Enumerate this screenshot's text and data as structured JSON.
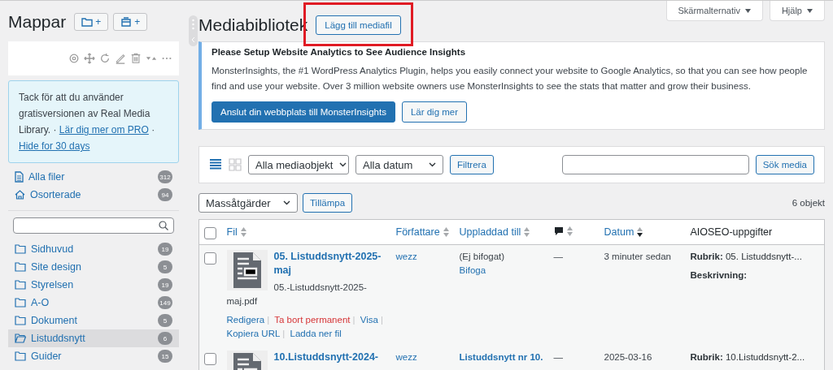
{
  "sidebar": {
    "title": "Mappar",
    "add_buttons": [
      {
        "kind": "folder",
        "label": "+"
      },
      {
        "kind": "collection",
        "label": "+"
      }
    ],
    "notice": [
      {
        "kind": "text",
        "text": "Tack för att du använder gratisversionen av Real Media Library. ·"
      },
      {
        "kind": "link",
        "text": "Lär dig mer om PRO"
      },
      {
        "kind": "text",
        "text": "·"
      },
      {
        "kind": "link",
        "text": "Hide for 30 days"
      }
    ],
    "special": [
      {
        "kind": "file",
        "label": "Alla filer",
        "count": "312"
      },
      {
        "kind": "home",
        "label": "Osorterade",
        "count": "94"
      }
    ],
    "folders": [
      {
        "label": "Sidhuvud",
        "count": "19",
        "selected": false
      },
      {
        "label": "Site design",
        "count": "5",
        "selected": false
      },
      {
        "label": "Styrelsen",
        "count": "19",
        "selected": false
      },
      {
        "label": "A-O",
        "count": "149",
        "selected": false
      },
      {
        "label": "Dokument",
        "count": "5",
        "selected": false
      },
      {
        "label": "Listuddsnytt",
        "count": "6",
        "selected": true
      },
      {
        "label": "Guider",
        "count": "15",
        "selected": false
      }
    ]
  },
  "header": {
    "title": "Mediabibliotek",
    "add_button": "Lägg till mediafil",
    "tabs": [
      "Skärmalternativ",
      "Hjälp"
    ]
  },
  "notice": {
    "title": "Please Setup Website Analytics to See Audience Insights",
    "text": "MonsterInsights, the #1 WordPress Analytics Plugin, helps you easily connect your website to Google Analytics, so that you can see how people find and use your website. Over 3 million website owners use MonsterInsights to see the stats that matter and grow their business.",
    "buttons": [
      {
        "kind": "primary",
        "label": "Anslut din webbplats till MonsterInsights"
      },
      {
        "kind": "secondary",
        "label": "Lär dig mer"
      }
    ]
  },
  "filters": {
    "views": [
      {
        "kind": "list",
        "selected": true
      },
      {
        "kind": "grid",
        "selected": false
      }
    ],
    "selects": [
      "Alla mediaobjekt",
      "Alla datum"
    ],
    "filter_button": "Filtrera",
    "search_button": "Sök media"
  },
  "bulk": {
    "select": "Massåtgärder",
    "apply": "Tillämpa",
    "count": "6 objekt"
  },
  "table": {
    "select_all_checked": false,
    "action_separator": "|",
    "columns": [
      {
        "kind": "text",
        "label": "Fil",
        "sortable": true,
        "sorted_desc": false
      },
      {
        "kind": "text",
        "label": "Författare",
        "sortable": true,
        "sorted_desc": false
      },
      {
        "kind": "text",
        "label": "Uppladdad till",
        "sortable": true,
        "sorted_desc": false
      },
      {
        "kind": "comment",
        "sortable": true,
        "sorted_desc": false
      },
      {
        "kind": "text",
        "label": "Datum",
        "sortable": true,
        "sorted_desc": true
      },
      {
        "kind": "plain",
        "label": "AIOSEO-uppgifter",
        "sortable": false
      }
    ],
    "rows": [
      {
        "checked": false,
        "title": "05. Listuddsnytt-2025-maj",
        "filename": "05.-Listuddsnytt-2025-maj.pdf",
        "actions": [
          {
            "kind": "normal",
            "label": "Redigera"
          },
          {
            "kind": "danger",
            "label": "Ta bort permanent"
          },
          {
            "kind": "normal",
            "label": "Visa"
          },
          {
            "kind": "normal",
            "label": "Kopiera URL"
          },
          {
            "kind": "normal",
            "label": "Ladda ner fil"
          }
        ],
        "author": "wezz",
        "uploaded": {
          "kind": "unattached",
          "note": "(Ej bifogat)",
          "link": "Bifoga"
        },
        "comments": "—",
        "date": "3 minuter sedan",
        "seo": [
          {
            "label": "Rubrik:",
            "value": "05. Listuddsnytt-..."
          },
          {
            "label": "Beskrivning:"
          }
        ]
      },
      {
        "checked": false,
        "title": "10.Listuddsnytt-2024-",
        "author": "wezz",
        "uploaded": {
          "kind": "attached",
          "link": "Listuddsnytt nr 10."
        },
        "comments": "—",
        "date": "2025-03-16",
        "seo": [
          {
            "label": "Rubrik:",
            "value": "10.Listuddsnytt-2..."
          }
        ]
      }
    ]
  }
}
